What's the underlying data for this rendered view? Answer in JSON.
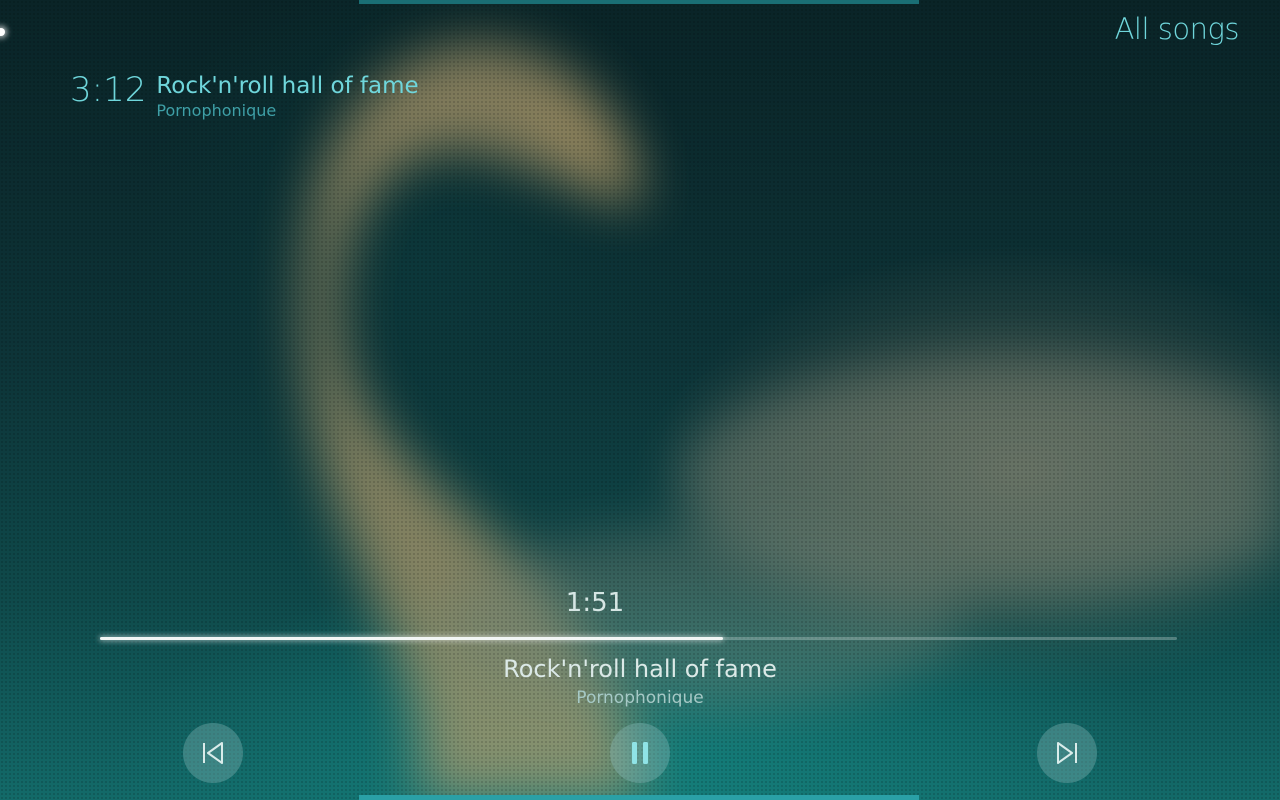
{
  "header": {
    "all_songs_label": "All songs"
  },
  "mini_player": {
    "duration": "3:12",
    "title": "Rock'n'roll hall of fame",
    "artist": "Pornophonique"
  },
  "player": {
    "position": "1:51",
    "progress_fraction": 0.578,
    "title": "Rock'n'roll hall of fame",
    "artist": "Pornophonique"
  },
  "controls": {
    "previous_icon": "skip-previous-icon",
    "play_pause_icon": "pause-icon",
    "next_icon": "skip-next-icon"
  },
  "colors": {
    "accent": "#6fd6db",
    "secondary": "#3e9fa6",
    "progress": "#f2f6f5"
  }
}
